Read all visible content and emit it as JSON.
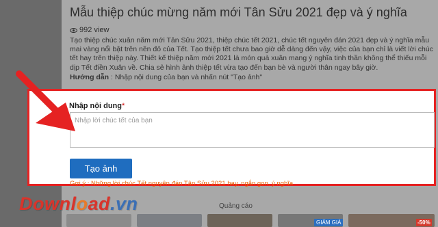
{
  "article": {
    "title": "Mẫu thiệp chúc mừng năm mới Tân Sửu 2021 đẹp và ý nghĩa",
    "views": "992 view",
    "description": "Tạo thiệp chúc xuân năm mới Tân Sửu 2021, thiệp chúc tết 2021, chúc tết nguyên đán 2021 đẹp và ý nghĩa mẫu mai vàng nổi bật trên nền đỏ của Tết. Tạo thiệp tết chưa bao giờ dễ dàng đến vậy, việc của bạn chỉ là viết lời chúc tết hay trên thiệp này. Thiết kế thiệp năm mới 2021 là món quà xuân mang ý nghĩa tinh thần không thể thiếu mỗi dịp Tết điền Xuân về. Chia sẻ hình ảnh thiệp tết vừa tạo đến bạn bè và người thân ngay bây giờ.",
    "guide_label": "Hướng dẫn",
    "guide_text": " : Nhập nội dung của bạn và nhấn nút \"Tạo ảnh\""
  },
  "form": {
    "field_label": "Nhập nội dung",
    "required_mark": "*",
    "placeholder": "Nhập lời chúc tết của bạn",
    "value": "",
    "submit_label": "Tạo ảnh",
    "hint": "Gợi ý : Những lời chúc Tết nguyên đán Tân Sửu 2021 hay, ngắn gọn, ý nghĩa"
  },
  "watermark": {
    "part1": "Downl",
    "part2": "o",
    "part3": "ad",
    "tld": ".vn"
  },
  "ads": {
    "label": "Quảng cáo",
    "badge": "GIẢM GIÁ",
    "discount": "-50%"
  },
  "colors": {
    "highlight_border": "#e52222",
    "arrow": "#e52222",
    "button": "#1f6dbf",
    "hint": "#e8630a"
  },
  "icons": {
    "views": "eye-icon",
    "annotation": "red-arrow"
  }
}
